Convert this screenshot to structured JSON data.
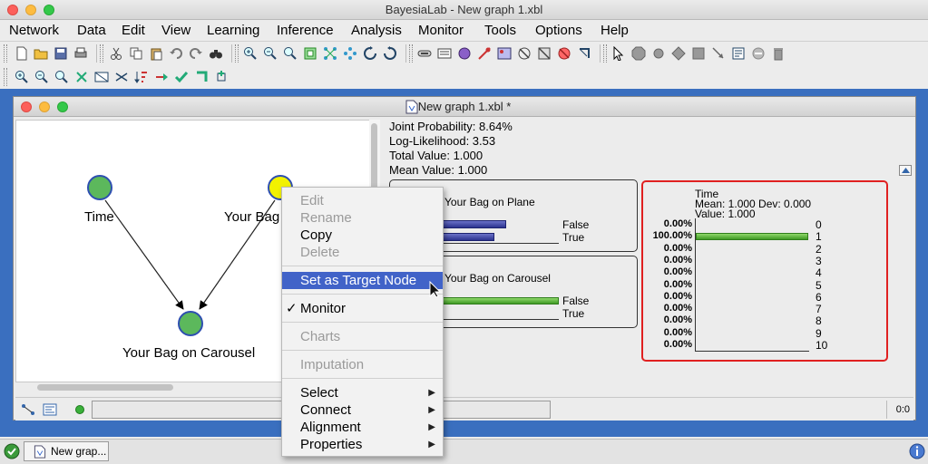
{
  "app": {
    "title": "BayesiaLab - New graph 1.xbl"
  },
  "menubar": [
    "Network",
    "Data",
    "Edit",
    "View",
    "Learning",
    "Inference",
    "Analysis",
    "Monitor",
    "Tools",
    "Options",
    "Help"
  ],
  "inner_window": {
    "title": "New graph 1.xbl *"
  },
  "graph": {
    "nodes": [
      {
        "label": "Time",
        "color": "#5cb85c"
      },
      {
        "label": "Your Bag",
        "color": "#f2f200"
      },
      {
        "label": "Your Bag on Carousel",
        "color": "#5cb85c"
      }
    ]
  },
  "stats": {
    "joint_probability": "Joint Probability: 8.64%",
    "log_likelihood": "Log-Likelihood: 3.53",
    "total_value": "Total Value: 1.000",
    "mean_value": "Mean Value: 1.000"
  },
  "monitors": {
    "plane": {
      "title": "Your Bag on Plane",
      "states": [
        {
          "label": "False",
          "probability": 0.55
        },
        {
          "label": "True",
          "probability": 0.45
        }
      ]
    },
    "carousel": {
      "title": "Your Bag on Carousel",
      "states": [
        {
          "label": "False",
          "probability": 1.0
        },
        {
          "label": "True",
          "probability": 0.0
        }
      ]
    },
    "time": {
      "title": "Time",
      "stats_line": "Mean: 1.000 Dev: 0.000",
      "value_line": "Value: 1.000",
      "rows": [
        {
          "pct": "0.00%",
          "state": "0",
          "probability": 0
        },
        {
          "pct": "100.00%",
          "state": "1",
          "probability": 1
        },
        {
          "pct": "0.00%",
          "state": "2",
          "probability": 0
        },
        {
          "pct": "0.00%",
          "state": "3",
          "probability": 0
        },
        {
          "pct": "0.00%",
          "state": "4",
          "probability": 0
        },
        {
          "pct": "0.00%",
          "state": "5",
          "probability": 0
        },
        {
          "pct": "0.00%",
          "state": "6",
          "probability": 0
        },
        {
          "pct": "0.00%",
          "state": "7",
          "probability": 0
        },
        {
          "pct": "0.00%",
          "state": "8",
          "probability": 0
        },
        {
          "pct": "0.00%",
          "state": "9",
          "probability": 0
        },
        {
          "pct": "0.00%",
          "state": "10",
          "probability": 0
        }
      ]
    }
  },
  "context_menu": {
    "edit": "Edit",
    "rename": "Rename",
    "copy": "Copy",
    "delete": "Delete",
    "set_target": "Set as Target Node",
    "monitor": "Monitor",
    "monitor_check": "✓",
    "charts": "Charts",
    "imputation": "Imputation",
    "select": "Select",
    "connect": "Connect",
    "alignment": "Alignment",
    "properties": "Properties"
  },
  "statusbar": {
    "coords": "0:0"
  },
  "taskbar": {
    "item": "New grap..."
  },
  "colors": {
    "desktop": "#3a6fbf",
    "highlight": "#4163c8",
    "target_border": "#e02020"
  }
}
